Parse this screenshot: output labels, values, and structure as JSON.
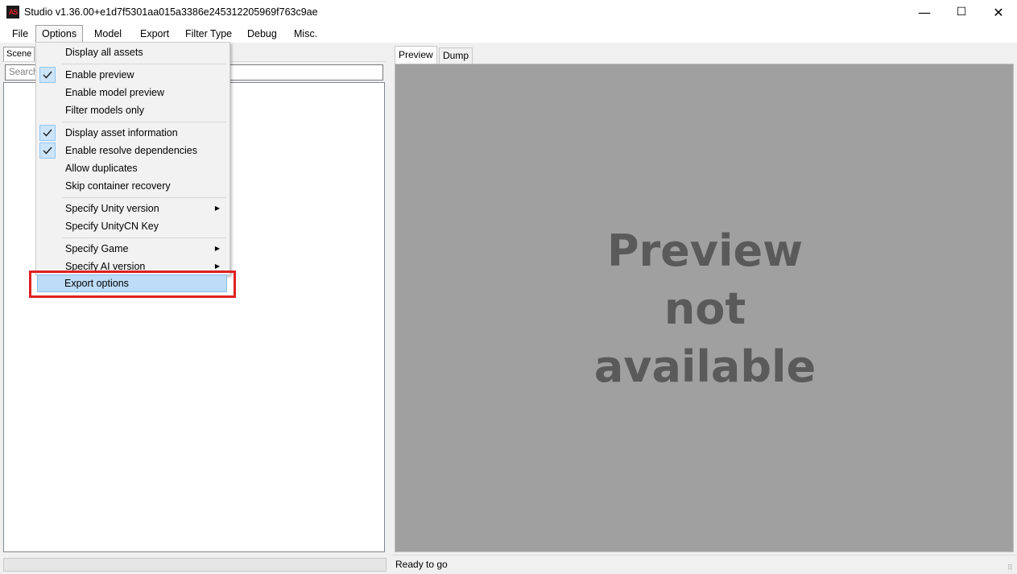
{
  "window": {
    "title": "Studio v1.36.00+e1d7f5301aa015a3386e245312205969f763c9ae",
    "icon_text": "AS",
    "minimize_glyph": "—",
    "maximize_glyph": "☐",
    "close_glyph": "✕"
  },
  "menubar": {
    "items": [
      "File",
      "Options",
      "Model",
      "Export",
      "Filter Type",
      "Debug",
      "Misc."
    ]
  },
  "left_panel": {
    "tab_label": "Scene",
    "search_placeholder": "Search"
  },
  "right_panel": {
    "tabs": [
      "Preview",
      "Dump"
    ],
    "preview_message": [
      "Preview",
      "not",
      "available"
    ],
    "status_text": "Ready to go"
  },
  "options_menu": {
    "items": [
      {
        "label": "Display all assets",
        "checked": false
      },
      {
        "label": "Enable preview",
        "checked": true
      },
      {
        "label": "Enable model preview",
        "checked": false
      },
      {
        "label": "Filter models only",
        "checked": false
      },
      {
        "label": "Display asset information",
        "checked": true
      },
      {
        "label": "Enable resolve dependencies",
        "checked": true
      },
      {
        "label": "Allow duplicates",
        "checked": false
      },
      {
        "label": "Skip container recovery",
        "checked": false
      },
      {
        "label": "Specify Unity version",
        "submenu": true
      },
      {
        "label": "Specify UnityCN Key",
        "submenu": false
      },
      {
        "label": "Specify Game",
        "submenu": true
      },
      {
        "label": "Specify AI version",
        "submenu": true
      },
      {
        "label": "Export options",
        "highlighted": true
      }
    ]
  },
  "colors": {
    "highlight": "#bcdcf7",
    "annotation_box": "#e02020",
    "preview_bg": "#a0a0a0",
    "preview_text": "#5a5a5a"
  }
}
